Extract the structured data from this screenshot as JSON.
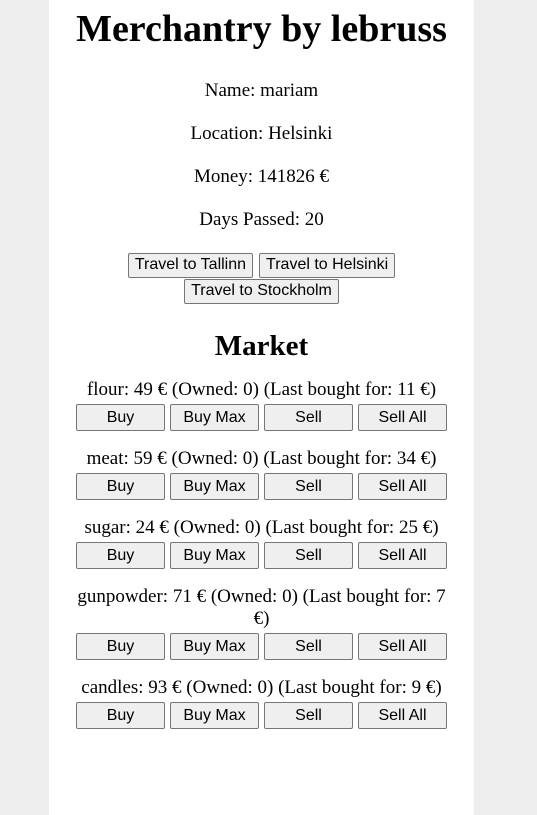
{
  "title": "Merchantry by lebruss",
  "player": {
    "name_line": "Name: mariam",
    "location_line": "Location: Helsinki",
    "money_line": "Money: 141826 €",
    "days_line": "Days Passed: 20"
  },
  "travel": [
    "Travel to Tallinn",
    "Travel to Helsinki",
    "Travel to Stockholm"
  ],
  "market": {
    "heading": "Market",
    "actions": {
      "buy": "Buy",
      "buy_max": "Buy Max",
      "sell": "Sell",
      "sell_all": "Sell All"
    },
    "items": [
      {
        "name": "flour",
        "text": "flour: 49 € (Owned: 0) (Last bought for: 11 €)"
      },
      {
        "name": "meat",
        "text": "meat: 59 € (Owned: 0) (Last bought for: 34 €)"
      },
      {
        "name": "sugar",
        "text": "sugar: 24 € (Owned: 0) (Last bought for: 25 €)"
      },
      {
        "name": "gunpowder",
        "text": "gunpowder: 71 € (Owned: 0) (Last bought for: 7 €)"
      },
      {
        "name": "candles",
        "text": "candles: 93 € (Owned: 0) (Last bought for: 9 €)"
      }
    ]
  }
}
